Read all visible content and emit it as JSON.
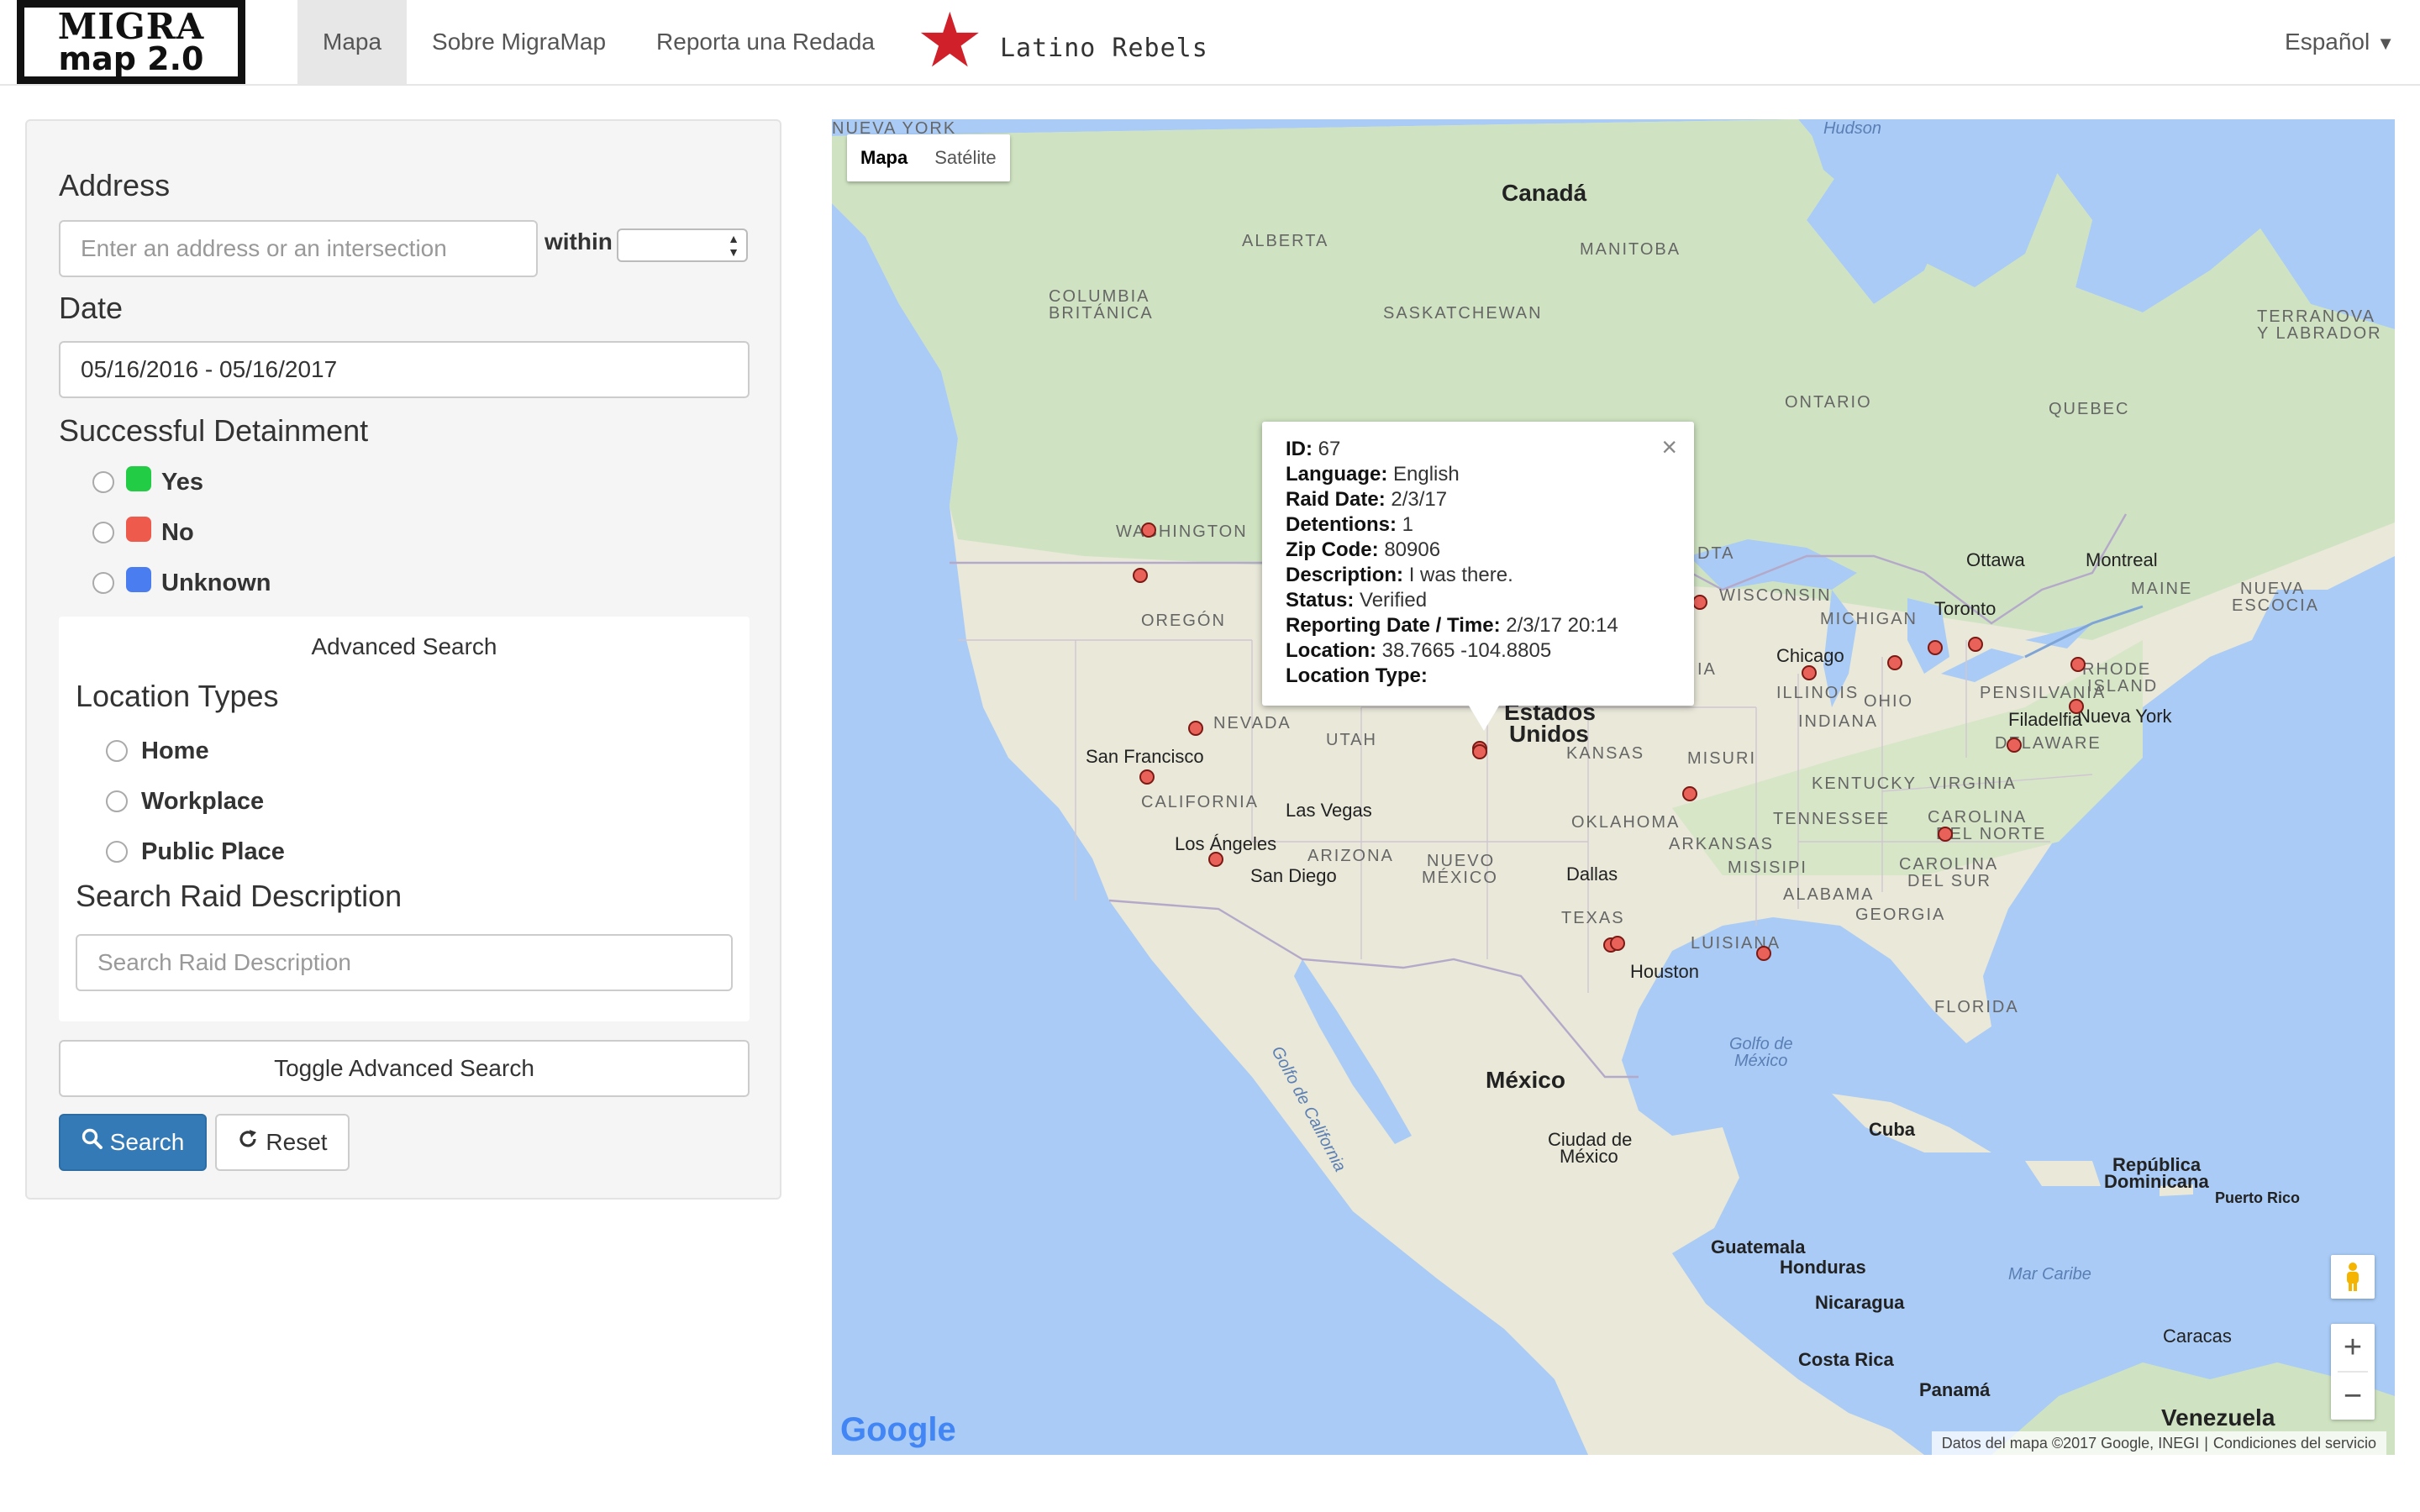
{
  "nav": {
    "logo_top": "MIGRA",
    "logo_bottom": "map 2.0",
    "items": [
      "Mapa",
      "Sobre MigraMap",
      "Reporta una Redada"
    ],
    "partner_logo": "Latino Rebels",
    "language": "Español",
    "language_caret": "▼"
  },
  "sidebar": {
    "address_label": "Address",
    "address_placeholder": "Enter an address or an intersection",
    "within_label": "within",
    "within_value": "",
    "date_label": "Date",
    "date_value": "05/16/2016 - 05/16/2017",
    "detainment_label": "Successful Detainment",
    "detainment_options": [
      {
        "label": "Yes",
        "color": "#22cc44"
      },
      {
        "label": "No",
        "color": "#ee5a4c"
      },
      {
        "label": "Unknown",
        "color": "#4a7ef0"
      }
    ],
    "advanced_title": "Advanced Search",
    "location_types_label": "Location Types",
    "location_types": [
      "Home",
      "Workplace",
      "Public Place"
    ],
    "raid_desc_label": "Search Raid Description",
    "raid_desc_placeholder": "Search Raid Description",
    "toggle_label": "Toggle Advanced Search",
    "search_label": "Search",
    "reset_label": "Reset"
  },
  "map": {
    "type_buttons": [
      "Mapa",
      "Satélite"
    ],
    "labels": {
      "canada": "Canadá",
      "hudson": "Hudson",
      "alberta": "ALBERTA",
      "manitoba": "MANITOBA",
      "bc1": "COLUMBIA",
      "bc2": "BRITÁNICA",
      "saskatchewan": "SASKATCHEWAN",
      "terranova1": "TERRANOVA",
      "terranova2": "Y LABRADOR",
      "ontario": "ONTARIO",
      "quebec": "QUEBEC",
      "washington": "WASHINGTON",
      "oregon": "OREGÓN",
      "nevada": "NEVADA",
      "utah": "UTAH",
      "california": "CALIFORNIA",
      "arizona": "ARIZONA",
      "nuevo_mexico1": "NUEVO",
      "nuevo_mexico2": "MÉXICO",
      "kansas": "KANSAS",
      "misuri": "MISURI",
      "oklahoma": "OKLAHOMA",
      "arkansas": "ARKANSAS",
      "texas": "TEXAS",
      "luisiana": "LUISIANA",
      "misisipi": "MISISIPI",
      "alabama": "ALABAMA",
      "georgia": "GEORGIA",
      "florida": "FLORIDA",
      "tennessee": "TENNESSEE",
      "kentucky": "KENTUCKY",
      "virginia": "VIRGINIA",
      "carolina_n1": "CAROLINA",
      "carolina_n2": "DEL NORTE",
      "carolina_s1": "CAROLINA",
      "carolina_s2": "DEL SUR",
      "illinois": "ILLINOIS",
      "indiana": "INDIANA",
      "ohio": "OHIO",
      "pensilvania": "PENSILVANIA",
      "michigan": "MICHIGAN",
      "wisconsin": "WISCONSIN",
      "dakota": "DTA",
      "nueva_york": "NUEVA YORK",
      "rhode1": "RHODE",
      "rhode2": "ISLAND",
      "delaware": "DELAWARE",
      "maine": "MAINE",
      "nueva_escocia1": "NUEVA",
      "nueva_escocia2": "ESCOCIA",
      "ia": "IA",
      "estados1": "Estados",
      "estados2": "Unidos",
      "mexico": "México",
      "ottawa": "Ottawa",
      "montreal": "Montreal",
      "toronto": "Toronto",
      "chicago": "Chicago",
      "filadelfia": "Filadelfia",
      "nueva_york_city": "Nueva York",
      "san_francisco": "San Francisco",
      "las_vegas": "Las Vegas",
      "los_angeles": "Los Ángeles",
      "san_diego": "San Diego",
      "dallas": "Dallas",
      "houston": "Houston",
      "cdmx1": "Ciudad de",
      "cdmx2": "México",
      "golfo_cal": "Golfo de California",
      "golfo_mex1": "Golfo de",
      "golfo_mex2": "México",
      "cuba": "Cuba",
      "rep_dom1": "República",
      "rep_dom2": "Dominicana",
      "puerto_rico": "Puerto Rico",
      "guatemala": "Guatemala",
      "honduras": "Honduras",
      "nicaragua": "Nicaragua",
      "costa_rica": "Costa Rica",
      "panama": "Panamá",
      "mar_caribe": "Mar Caribe",
      "caracas": "Caracas",
      "venezuela": "Venezuela"
    },
    "infowindow": {
      "rows": [
        {
          "k": "ID:",
          "v": "67"
        },
        {
          "k": "Language:",
          "v": "English"
        },
        {
          "k": "Raid Date:",
          "v": "2/3/17"
        },
        {
          "k": "Detentions:",
          "v": "1"
        },
        {
          "k": "Zip Code:",
          "v": "80906"
        },
        {
          "k": "Description:",
          "v": "I was there."
        },
        {
          "k": "Status:",
          "v": "Verified"
        },
        {
          "k": "Reporting Date / Time:",
          "v": "2/3/17 20:14"
        },
        {
          "k": "Location:",
          "v": "38.7665 -104.8805"
        },
        {
          "k": "Location Type:",
          "v": ""
        }
      ],
      "close": "×"
    },
    "zoom_in": "+",
    "zoom_out": "−",
    "google": "Google",
    "attribution_data": "Datos del mapa ©2017 Google, INEGI",
    "attribution_terms": "Condiciones del servicio"
  }
}
